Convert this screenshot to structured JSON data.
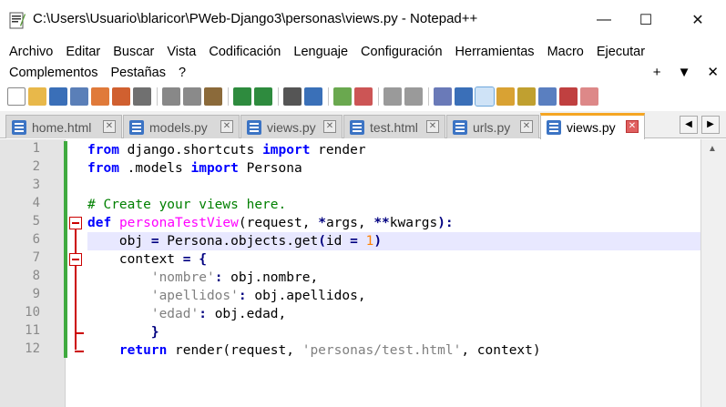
{
  "window": {
    "title": "C:\\Users\\Usuario\\blaricor\\PWeb-Django3\\personas\\views.py - Notepad++",
    "minimize": "—",
    "maximize": "☐",
    "close": "✕"
  },
  "menu": {
    "row1": [
      "Archivo",
      "Editar",
      "Buscar",
      "Vista",
      "Codificación",
      "Lenguaje",
      "Configuración",
      "Herramientas",
      "Macro",
      "Ejecutar"
    ],
    "row2": [
      "Complementos",
      "Pestañas",
      "?"
    ],
    "right": [
      "+",
      "▼",
      "✕"
    ]
  },
  "tabs": [
    {
      "label": "home.html",
      "close": "✕"
    },
    {
      "label": "models.py",
      "close": "✕"
    },
    {
      "label": "views.py",
      "close": "✕"
    },
    {
      "label": "test.html",
      "close": "✕"
    },
    {
      "label": "urls.py",
      "close": "✕"
    },
    {
      "label": "views.py",
      "close": "✕",
      "active": true
    }
  ],
  "tab_nav": {
    "left": "◀",
    "right": "▶"
  },
  "editor": {
    "line_numbers": [
      "1",
      "2",
      "3",
      "4",
      "5",
      "6",
      "7",
      "8",
      "9",
      "10",
      "11",
      "12"
    ],
    "current_line": 6,
    "colors": {
      "keyword": "#0000ff",
      "comment": "#008000",
      "function": "#ff00ff",
      "string": "#808080",
      "number": "#ff8000",
      "change_bar": "#3faa3f",
      "fold": "#cc0000"
    }
  },
  "code": {
    "l1": {
      "k1": "from",
      "t1": " django.shortcuts ",
      "k2": "import",
      "t2": " render"
    },
    "l2": {
      "k1": "from",
      "t1": " .models ",
      "k2": "import",
      "t2": " Persona"
    },
    "l4": {
      "c": "# Create your views here."
    },
    "l5": {
      "k1": "def",
      "sp": " ",
      "fn": "personaTestView",
      "t1": "(request, ",
      "o1": "*",
      "t2": "args, ",
      "o2": "**",
      "t3": "kwargs",
      "o3": "):"
    },
    "l6": {
      "ind": "    ",
      "t1": "obj ",
      "o1": "=",
      "t2": " Persona.objects.get",
      "o2": "(",
      "t3": "id ",
      "o3": "=",
      "sp": " ",
      "n": "1",
      "o4": ")"
    },
    "l7": {
      "ind": "    ",
      "t1": "context ",
      "o1": "=",
      "sp": " ",
      "o2": "{"
    },
    "l8": {
      "ind": "        ",
      "s": "'nombre'",
      "o1": ":",
      "t1": " obj.nombre,"
    },
    "l9": {
      "ind": "        ",
      "s": "'apellidos'",
      "o1": ":",
      "t1": " obj.apellidos,"
    },
    "l10": {
      "ind": "        ",
      "s": "'edad'",
      "o1": ":",
      "t1": " obj.edad,"
    },
    "l11": {
      "ind": "        ",
      "o1": "}"
    },
    "l12": {
      "ind": "    ",
      "k1": "return",
      "t1": " render(request, ",
      "s": "'personas/test.html'",
      "t2": ", context)"
    }
  }
}
